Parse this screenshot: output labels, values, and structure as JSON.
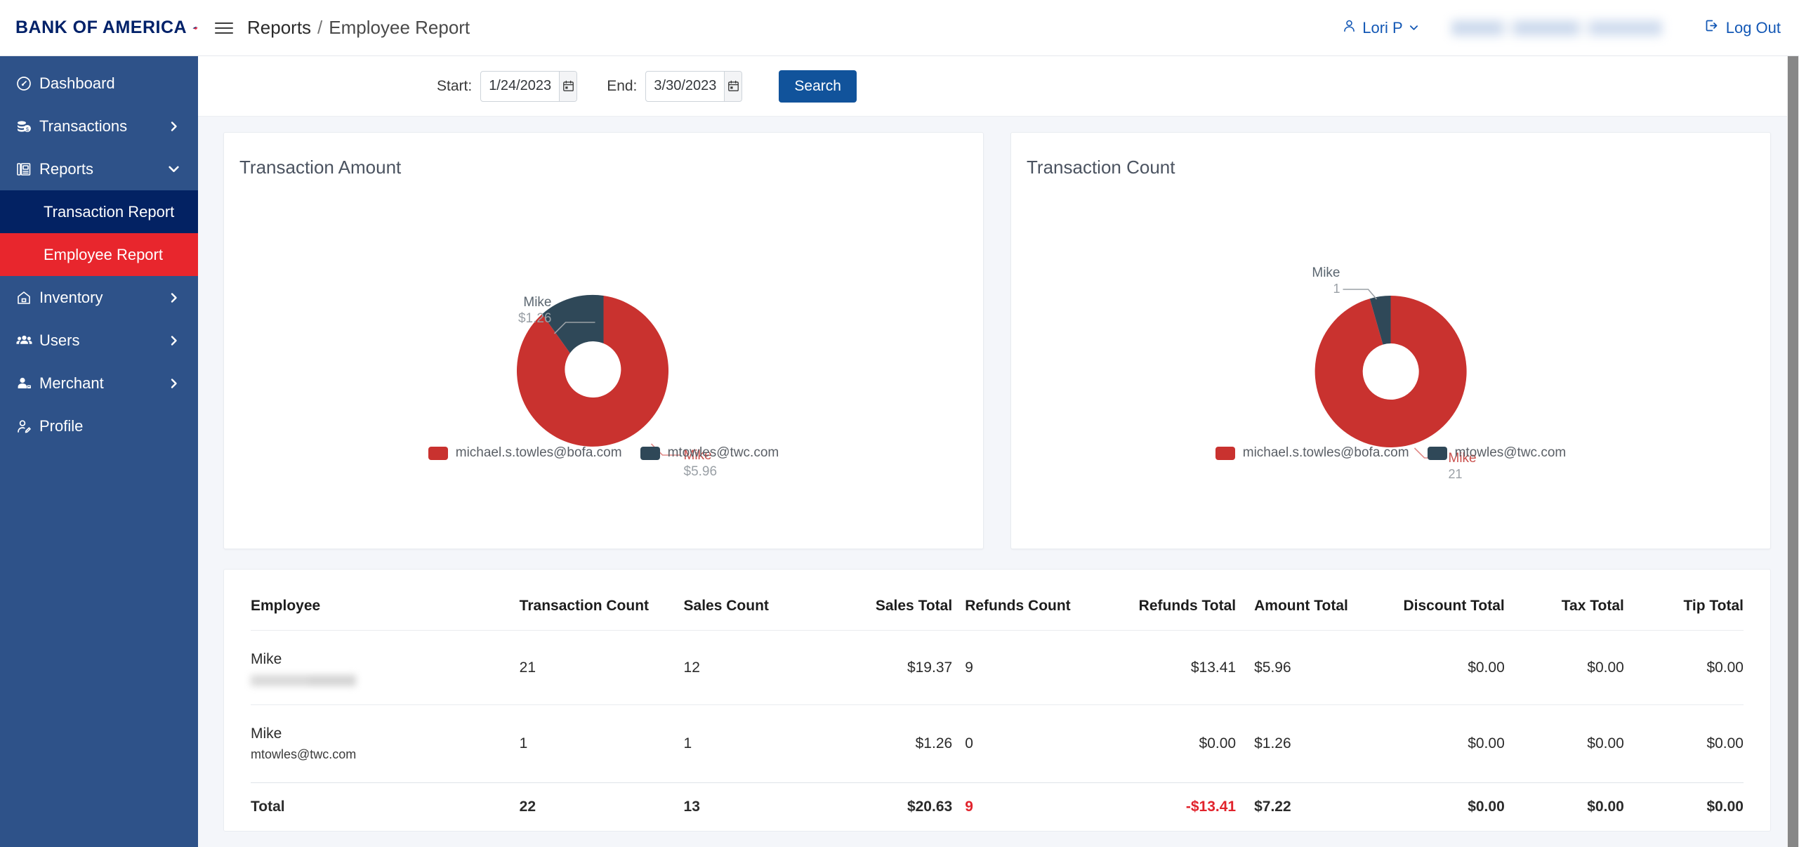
{
  "brand": {
    "name": "BANK OF AMERICA",
    "logo_icon": "bofa-flag-logo"
  },
  "sidebar": {
    "items": [
      {
        "label": "Dashboard",
        "icon": "dashboard-icon",
        "expandable": false
      },
      {
        "label": "Transactions",
        "icon": "transactions-icon",
        "expandable": true,
        "chevron": "chevron-right-icon"
      },
      {
        "label": "Reports",
        "icon": "reports-icon",
        "expandable": true,
        "chevron": "chevron-down-icon"
      },
      {
        "label": "Inventory",
        "icon": "inventory-icon",
        "expandable": true,
        "chevron": "chevron-right-icon"
      },
      {
        "label": "Users",
        "icon": "users-icon",
        "expandable": true,
        "chevron": "chevron-right-icon"
      },
      {
        "label": "Merchant",
        "icon": "merchant-icon",
        "expandable": true,
        "chevron": "chevron-right-icon"
      },
      {
        "label": "Profile",
        "icon": "profile-icon",
        "expandable": false
      }
    ],
    "reports_subitems": [
      {
        "label": "Transaction Report",
        "state": "visited"
      },
      {
        "label": "Employee Report",
        "state": "active"
      }
    ]
  },
  "header": {
    "menu_icon": "hamburger-menu-icon",
    "breadcrumb_parent": "Reports",
    "breadcrumb_sep": "/",
    "breadcrumb_current": "Employee Report",
    "user_icon": "user-avatar-icon",
    "user_name": "Lori P",
    "user_chevron": "chevron-down-icon",
    "merchant_name_redacted": "",
    "logout_icon": "logout-icon",
    "logout_label": "Log Out"
  },
  "filters": {
    "start_label": "Start:",
    "start_value": "1/24/2023",
    "end_label": "End:",
    "end_value": "3/30/2023",
    "calendar_icon": "calendar-icon",
    "search_label": "Search"
  },
  "colors": {
    "series_red": "#c9322f",
    "series_dark": "#2f4858",
    "accent_blue": "#11539b",
    "sidebar_blue": "#2e5289",
    "active_red": "#e8262d",
    "visited_navy": "#032263",
    "negative": "#e1232c"
  },
  "chart_data": [
    {
      "type": "pie",
      "variant": "donut",
      "title": "Transaction Amount",
      "categories": [
        "michael.s.towles@bofa.com",
        "mtowles@twc.com"
      ],
      "values": [
        5.96,
        1.26
      ],
      "value_labels": [
        "$5.96",
        "$1.26"
      ],
      "point_names": [
        "Mike",
        "Mike"
      ],
      "colors": [
        "#c9322f",
        "#2f4858"
      ],
      "legend": [
        "michael.s.towles@bofa.com",
        "mtowles@twc.com"
      ],
      "legend_position": "bottom",
      "total": 7.22
    },
    {
      "type": "pie",
      "variant": "donut",
      "title": "Transaction Count",
      "categories": [
        "michael.s.towles@bofa.com",
        "mtowles@twc.com"
      ],
      "values": [
        21,
        1
      ],
      "value_labels": [
        "21",
        "1"
      ],
      "point_names": [
        "Mike",
        "Mike"
      ],
      "colors": [
        "#c9322f",
        "#2f4858"
      ],
      "legend": [
        "michael.s.towles@bofa.com",
        "mtowles@twc.com"
      ],
      "legend_position": "bottom",
      "total": 22
    }
  ],
  "table": {
    "columns": [
      "Employee",
      "Transaction Count",
      "Sales Count",
      "Sales Total",
      "Refunds Count",
      "Refunds Total",
      "Amount Total",
      "Discount Total",
      "Tax Total",
      "Tip Total"
    ],
    "rows": [
      {
        "employee_name": "Mike",
        "employee_email": "",
        "email_redacted": true,
        "transaction_count": "21",
        "sales_count": "12",
        "sales_total": "$19.37",
        "refunds_count": "9",
        "refunds_total": "$13.41",
        "amount_total": "$5.96",
        "discount_total": "$0.00",
        "tax_total": "$0.00",
        "tip_total": "$0.00"
      },
      {
        "employee_name": "Mike",
        "employee_email": "mtowles@twc.com",
        "email_redacted": false,
        "transaction_count": "1",
        "sales_count": "1",
        "sales_total": "$1.26",
        "refunds_count": "0",
        "refunds_total": "$0.00",
        "amount_total": "$1.26",
        "discount_total": "$0.00",
        "tax_total": "$0.00",
        "tip_total": "$0.00"
      }
    ],
    "total_row": {
      "label": "Total",
      "transaction_count": "22",
      "sales_count": "13",
      "sales_total": "$20.63",
      "refunds_count": "9",
      "refunds_total": "-$13.41",
      "amount_total": "$7.22",
      "discount_total": "$0.00",
      "tax_total": "$0.00",
      "tip_total": "$0.00"
    }
  }
}
